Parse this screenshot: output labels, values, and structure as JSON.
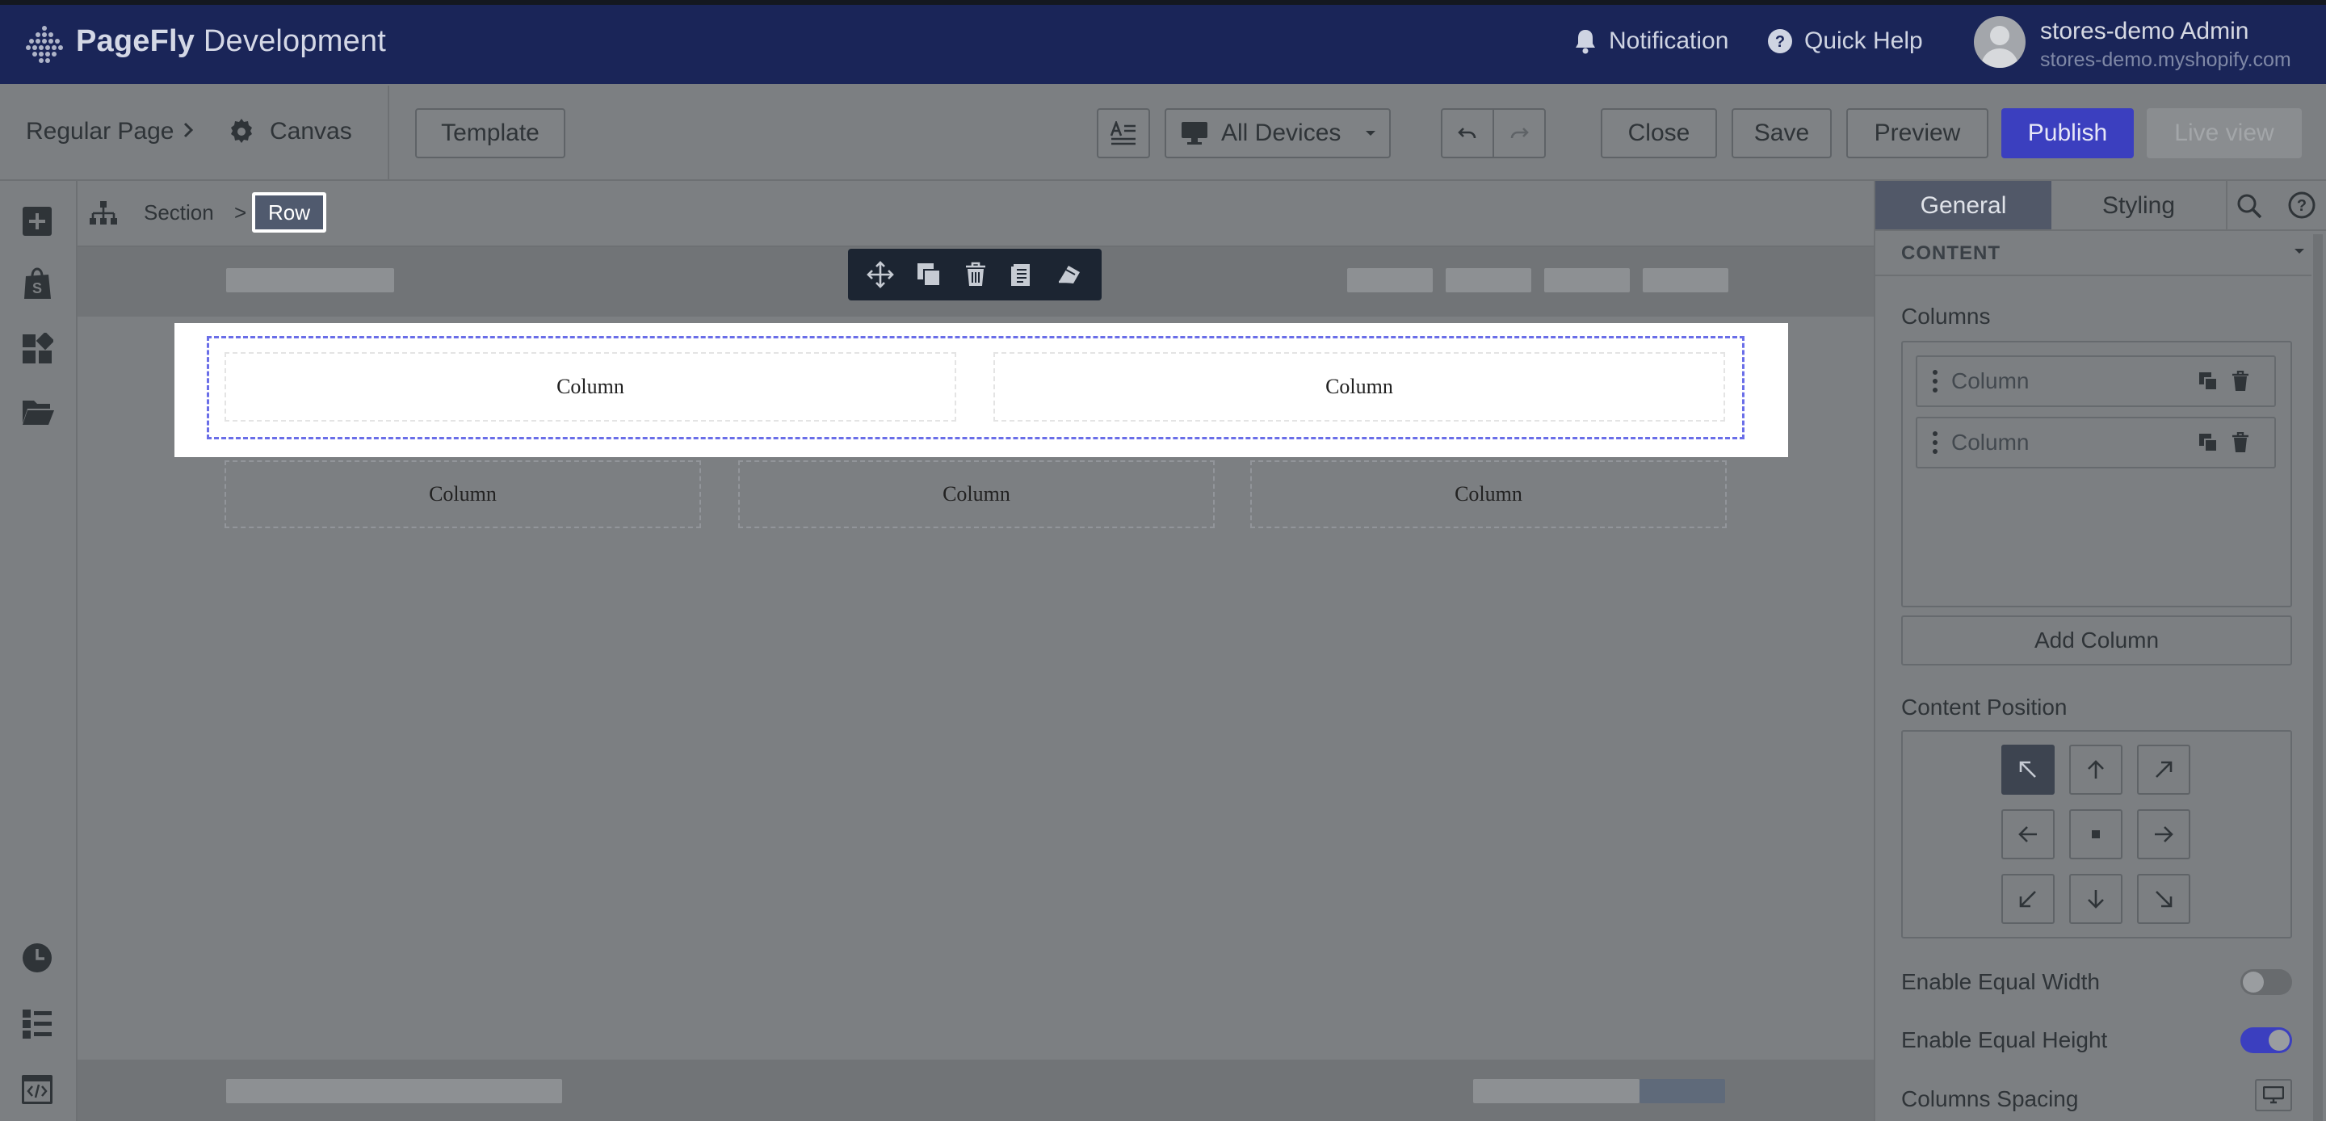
{
  "topbar": {
    "brand_bold": "PageFly",
    "brand_rest": " Development",
    "notification": "Notification",
    "quick_help": "Quick Help",
    "user_name": "stores-demo Admin",
    "user_store": "stores-demo.myshopify.com"
  },
  "toolbar": {
    "page_type": "Regular Page",
    "canvas": "Canvas",
    "template": "Template",
    "devices": "All Devices",
    "close": "Close",
    "save": "Save",
    "preview": "Preview",
    "publish": "Publish",
    "live_view": "Live view"
  },
  "breadcrumb": {
    "section": "Section",
    "sep": ">",
    "row": "Row"
  },
  "canvas": {
    "row_columns": [
      "Column",
      "Column"
    ],
    "below_columns": [
      "Column",
      "Column",
      "Column"
    ]
  },
  "panel": {
    "tab_general": "General",
    "tab_styling": "Styling",
    "content_header": "CONTENT",
    "columns_label": "Columns",
    "column_items": [
      "Column",
      "Column"
    ],
    "add_column": "Add Column",
    "content_position": "Content Position",
    "equal_width": "Enable Equal Width",
    "equal_height": "Enable Equal Height",
    "columns_spacing": "Columns Spacing",
    "equal_width_on": false,
    "equal_height_on": true
  },
  "colors": {
    "topbar": "#1a2558",
    "publish": "#3b3fbf",
    "selection": "#6a6ee8"
  }
}
